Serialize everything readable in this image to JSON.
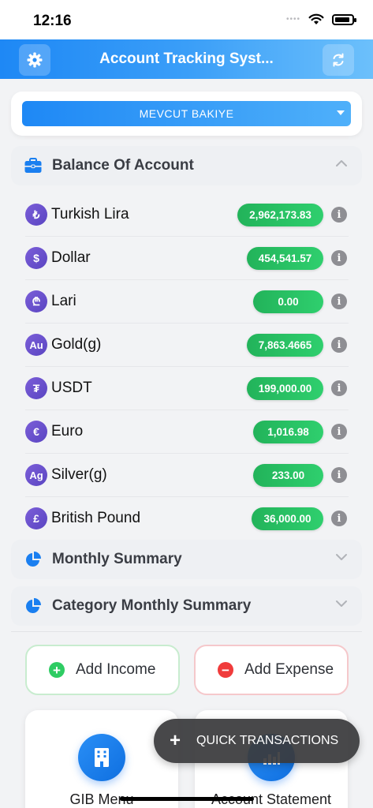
{
  "status_bar": {
    "time": "12:16",
    "dots": "••••"
  },
  "header": {
    "title": "Account Tracking Syst...",
    "settings_icon": "gear-icon",
    "refresh_icon": "refresh-icon"
  },
  "selector": {
    "value": "MEVCUT BAKIYE"
  },
  "balance_section": {
    "label": "Balance Of Account",
    "icon": "briefcase-icon",
    "items": [
      {
        "symbol": "₺",
        "name": "Turkish Lira",
        "amount": "2,962,173.83",
        "info": "i"
      },
      {
        "symbol": "$",
        "name": "Dollar",
        "amount": "454,541.57",
        "info": "i"
      },
      {
        "symbol": "₾",
        "name": "Lari",
        "amount": "0.00",
        "info": "i"
      },
      {
        "symbol": "Au",
        "name": "Gold(g)",
        "amount": "7,863.4665",
        "info": "i"
      },
      {
        "symbol": "₮",
        "name": "USDT",
        "amount": "199,000.00",
        "info": "i"
      },
      {
        "symbol": "€",
        "name": "Euro",
        "amount": "1,016.98",
        "info": "i"
      },
      {
        "symbol": "Ag",
        "name": "Silver(g)",
        "amount": "233.00",
        "info": "i"
      },
      {
        "symbol": "£",
        "name": "British Pound",
        "amount": "36,000.00",
        "info": "i"
      }
    ]
  },
  "monthly_summary": {
    "label": "Monthly Summary",
    "icon": "pie-chart-icon"
  },
  "category_summary": {
    "label": "Category Monthly Summary",
    "icon": "pie-chart-icon"
  },
  "actions": {
    "income_label": "Add Income",
    "income_symbol": "+",
    "expense_label": "Add Expense",
    "expense_symbol": "−"
  },
  "tiles": {
    "gib_label": "GIB Menu",
    "statement_label": "Account Statement"
  },
  "fab": {
    "symbol": "+",
    "label": "QUICK TRANSACTIONS"
  },
  "colors": {
    "header_start": "#1e88f5",
    "header_end": "#6cc0fb",
    "amount_green": "#22b35a",
    "currency_purple": "#6a50cc"
  }
}
